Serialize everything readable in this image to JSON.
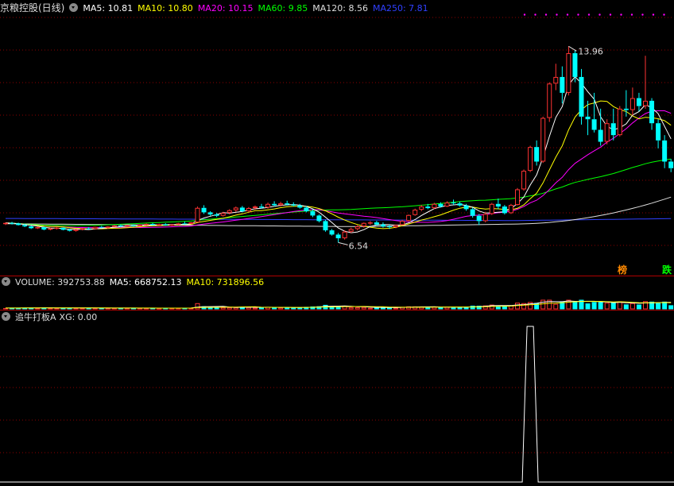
{
  "main_header": {
    "title": "京粮控股(日线)",
    "ma": [
      {
        "label": "MA5: 10.81",
        "color": "#ffffff"
      },
      {
        "label": "MA10: 10.80",
        "color": "#ffff00"
      },
      {
        "label": "MA20: 10.15",
        "color": "#ff00ff"
      },
      {
        "label": "MA60: 9.85",
        "color": "#00ff00"
      },
      {
        "label": "MA120: 8.56",
        "color": "#dddddd"
      },
      {
        "label": "MA250: 7.81",
        "color": "#3040ff"
      }
    ]
  },
  "vol_header": {
    "label": "VOLUME: 392753.88",
    "ma5": "MA5: 668752.13",
    "ma10": "MA10: 731896.56"
  },
  "ind_header": {
    "label": "追牛打板A",
    "xg": "XG: 0.00"
  },
  "tags": {
    "bang": "榜",
    "die": "跌"
  },
  "colors": {
    "up": "#ff3333",
    "down": "#00ffff",
    "grid": "#8b0000",
    "frame": "#b00000"
  },
  "chart_data": {
    "type": "candlestick",
    "price_ylim": [
      5.5,
      15.2
    ],
    "high_label": "13.96",
    "low_label": "6.54",
    "ohlc": [
      [
        7.25,
        7.3,
        7.2,
        7.28
      ],
      [
        7.28,
        7.32,
        7.22,
        7.26
      ],
      [
        7.26,
        7.29,
        7.18,
        7.2
      ],
      [
        7.2,
        7.24,
        7.12,
        7.15
      ],
      [
        7.15,
        7.18,
        7.05,
        7.08
      ],
      [
        7.08,
        7.15,
        7.05,
        7.12
      ],
      [
        7.12,
        7.14,
        7.0,
        7.03
      ],
      [
        7.03,
        7.1,
        7.0,
        7.07
      ],
      [
        7.07,
        7.12,
        7.03,
        7.1
      ],
      [
        7.1,
        7.11,
        7.0,
        7.02
      ],
      [
        7.02,
        7.06,
        6.96,
        6.98
      ],
      [
        6.98,
        7.05,
        6.95,
        7.03
      ],
      [
        7.03,
        7.09,
        7.0,
        7.07
      ],
      [
        7.07,
        7.12,
        7.03,
        7.05
      ],
      [
        7.05,
        7.14,
        7.04,
        7.13
      ],
      [
        7.13,
        7.17,
        7.08,
        7.1
      ],
      [
        7.1,
        7.16,
        7.06,
        7.14
      ],
      [
        7.14,
        7.2,
        7.12,
        7.18
      ],
      [
        7.18,
        7.22,
        7.12,
        7.15
      ],
      [
        7.15,
        7.21,
        7.13,
        7.19
      ],
      [
        7.19,
        7.23,
        7.14,
        7.16
      ],
      [
        7.16,
        7.22,
        7.15,
        7.21
      ],
      [
        7.21,
        7.26,
        7.18,
        7.24
      ],
      [
        7.24,
        7.28,
        7.18,
        7.2
      ],
      [
        7.2,
        7.25,
        7.19,
        7.23
      ],
      [
        7.23,
        7.27,
        7.17,
        7.19
      ],
      [
        7.19,
        7.24,
        7.16,
        7.22
      ],
      [
        7.22,
        7.28,
        7.2,
        7.26
      ],
      [
        7.26,
        7.33,
        7.22,
        7.24
      ],
      [
        7.24,
        7.31,
        7.22,
        7.3
      ],
      [
        7.3,
        7.9,
        7.3,
        7.85
      ],
      [
        7.85,
        7.95,
        7.62,
        7.68
      ],
      [
        7.68,
        7.72,
        7.55,
        7.6
      ],
      [
        7.6,
        7.66,
        7.5,
        7.55
      ],
      [
        7.55,
        7.7,
        7.52,
        7.66
      ],
      [
        7.66,
        7.8,
        7.6,
        7.76
      ],
      [
        7.76,
        7.9,
        7.7,
        7.86
      ],
      [
        7.86,
        7.92,
        7.68,
        7.72
      ],
      [
        7.72,
        7.88,
        7.68,
        7.84
      ],
      [
        7.84,
        7.94,
        7.78,
        7.9
      ],
      [
        7.9,
        8.0,
        7.82,
        7.86
      ],
      [
        7.86,
        8.05,
        7.82,
        8.0
      ],
      [
        8.0,
        8.1,
        7.9,
        7.95
      ],
      [
        7.95,
        8.08,
        7.9,
        8.02
      ],
      [
        8.02,
        8.12,
        7.94,
        7.98
      ],
      [
        7.98,
        8.06,
        7.9,
        7.94
      ],
      [
        7.94,
        8.0,
        7.82,
        7.86
      ],
      [
        7.86,
        7.92,
        7.68,
        7.72
      ],
      [
        7.72,
        7.8,
        7.5,
        7.56
      ],
      [
        7.56,
        7.6,
        7.3,
        7.35
      ],
      [
        7.35,
        7.4,
        6.95,
        7.0
      ],
      [
        7.0,
        7.05,
        6.8,
        6.84
      ],
      [
        6.84,
        6.9,
        6.54,
        6.7
      ],
      [
        6.7,
        7.0,
        6.65,
        6.95
      ],
      [
        6.95,
        7.1,
        6.9,
        7.05
      ],
      [
        7.05,
        7.2,
        7.0,
        7.15
      ],
      [
        7.15,
        7.3,
        7.1,
        7.28
      ],
      [
        7.28,
        7.35,
        7.2,
        7.3
      ],
      [
        7.3,
        7.36,
        7.18,
        7.22
      ],
      [
        7.22,
        7.3,
        7.1,
        7.15
      ],
      [
        7.15,
        7.22,
        7.05,
        7.12
      ],
      [
        7.12,
        7.22,
        7.08,
        7.2
      ],
      [
        7.2,
        7.4,
        7.18,
        7.36
      ],
      [
        7.36,
        7.6,
        7.34,
        7.58
      ],
      [
        7.58,
        7.82,
        7.55,
        7.78
      ],
      [
        7.78,
        7.96,
        7.72,
        7.9
      ],
      [
        7.9,
        8.0,
        7.8,
        7.84
      ],
      [
        7.84,
        8.04,
        7.8,
        8.0
      ],
      [
        8.0,
        8.06,
        7.86,
        7.9
      ],
      [
        7.9,
        8.1,
        7.88,
        8.05
      ],
      [
        8.05,
        8.16,
        7.96,
        8.02
      ],
      [
        8.02,
        8.08,
        7.9,
        7.94
      ],
      [
        7.94,
        8.0,
        7.74,
        7.8
      ],
      [
        7.8,
        7.86,
        7.48,
        7.55
      ],
      [
        7.55,
        7.62,
        7.2,
        7.35
      ],
      [
        7.35,
        7.7,
        7.3,
        7.62
      ],
      [
        7.62,
        8.04,
        7.58,
        8.0
      ],
      [
        8.0,
        8.2,
        7.8,
        7.9
      ],
      [
        7.9,
        7.96,
        7.6,
        7.65
      ],
      [
        7.65,
        8.0,
        7.62,
        7.96
      ],
      [
        7.96,
        8.6,
        7.94,
        8.55
      ],
      [
        8.55,
        9.3,
        8.5,
        9.25
      ],
      [
        9.25,
        10.2,
        9.2,
        10.15
      ],
      [
        10.15,
        10.4,
        9.45,
        9.6
      ],
      [
        9.6,
        11.3,
        9.55,
        11.25
      ],
      [
        11.25,
        12.6,
        11.1,
        12.55
      ],
      [
        12.55,
        13.3,
        12.3,
        12.8
      ],
      [
        12.8,
        13.2,
        11.8,
        12.2
      ],
      [
        12.2,
        13.96,
        12.1,
        13.7
      ],
      [
        13.7,
        13.8,
        12.6,
        12.8
      ],
      [
        12.8,
        13.1,
        11.0,
        11.3
      ],
      [
        11.3,
        11.9,
        10.6,
        11.2
      ],
      [
        11.2,
        12.2,
        10.7,
        10.8
      ],
      [
        10.8,
        11.6,
        10.2,
        10.35
      ],
      [
        10.35,
        11.2,
        10.25,
        11.05
      ],
      [
        11.05,
        11.6,
        10.4,
        10.6
      ],
      [
        10.6,
        11.7,
        10.55,
        11.6
      ],
      [
        11.6,
        12.3,
        11.3,
        11.55
      ],
      [
        11.55,
        12.4,
        11.35,
        12.0
      ],
      [
        12.0,
        12.2,
        11.5,
        11.7
      ],
      [
        11.7,
        13.6,
        11.6,
        11.9
      ],
      [
        11.9,
        12.0,
        10.8,
        11.05
      ],
      [
        11.05,
        11.2,
        10.1,
        10.4
      ],
      [
        10.4,
        10.6,
        9.35,
        9.6
      ],
      [
        9.6,
        9.7,
        9.2,
        9.35
      ]
    ],
    "ma5_last": 10.81,
    "ma10_last": 10.8,
    "ma20_last": 10.15,
    "ma60_last": 9.85,
    "ma120_last": 8.56,
    "ma250_last": 7.81,
    "volume_last": 392753.88,
    "volume_ma5": 668752.13,
    "volume_ma10": 731896.56,
    "xg_value": 0.0
  }
}
